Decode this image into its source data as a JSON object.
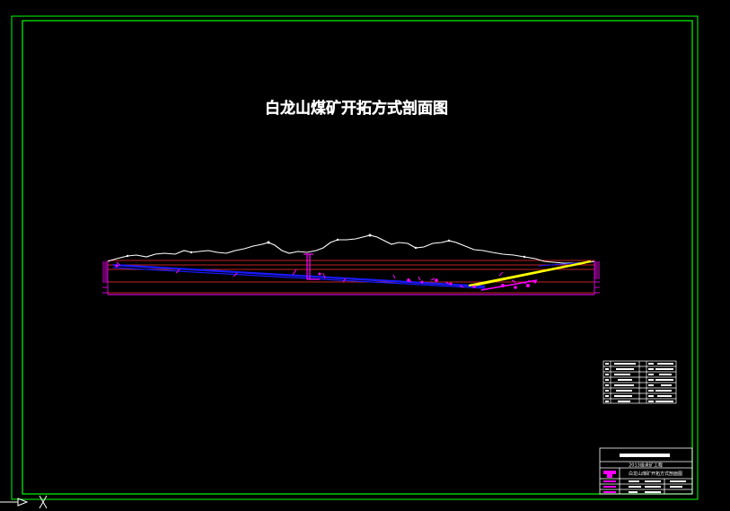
{
  "drawing": {
    "title": "白龙山煤矿开拓方式剖面图"
  },
  "title_block": {
    "school": "2013级采矿工程",
    "drawing_name": "白龙山煤矿开拓方式剖面图"
  },
  "colors": {
    "background": "#000000",
    "frame": "#00ff00",
    "title_text": "#ffffff",
    "terrain": "#ffffff",
    "strata": "#ff3030",
    "seam": "#1a1aff",
    "mine_works": "#ff00ff",
    "incline": "#ffff00",
    "table_lines": "#ffffff"
  },
  "icons": {
    "ucs_axis": "ucs-axis-icon"
  }
}
